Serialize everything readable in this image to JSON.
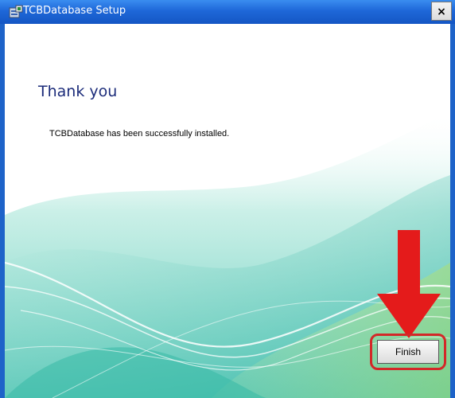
{
  "window": {
    "title": "TCBDatabase Setup",
    "close_label": "×"
  },
  "content": {
    "heading": "Thank you",
    "message": "TCBDatabase has been successfully installed."
  },
  "footer": {
    "finish_label": "Finish"
  },
  "colors": {
    "titlebar": "#1e67d8",
    "heading": "#1c2c7a",
    "annotation": "#e41b1b",
    "wave_teal": "#4fc9b7"
  },
  "icons": {
    "title": "installer-icon",
    "annotation": "arrow-down-icon"
  }
}
